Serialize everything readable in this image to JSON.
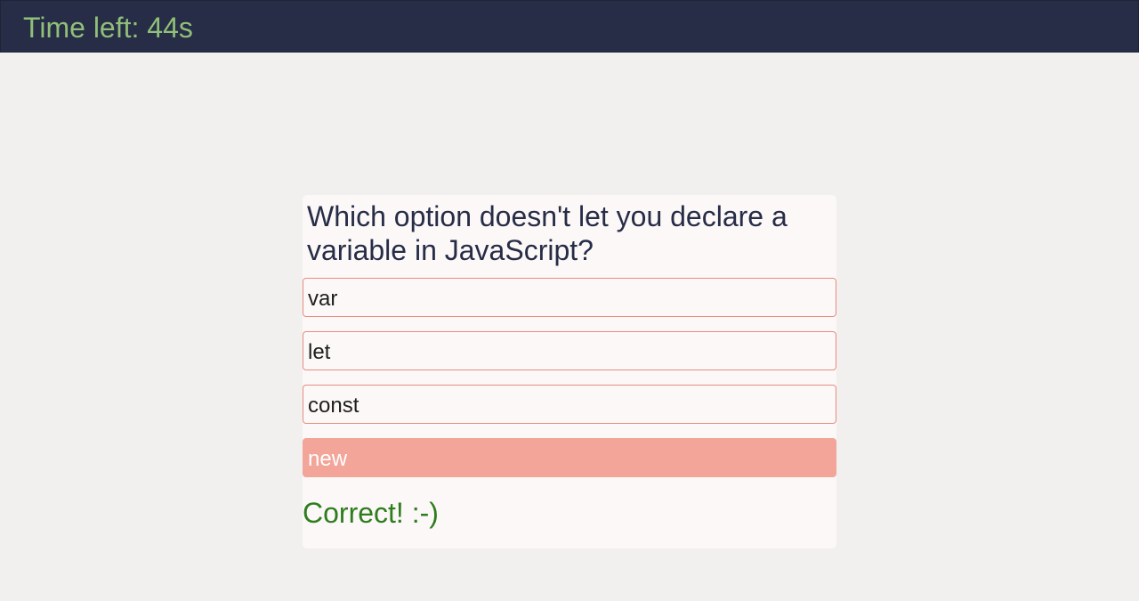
{
  "header": {
    "timer_text": "Time left: 44s"
  },
  "quiz": {
    "question": "Which option doesn't let you declare a variable in JavaScript?",
    "options": [
      {
        "label": "var",
        "selected": false
      },
      {
        "label": "let",
        "selected": false
      },
      {
        "label": "const",
        "selected": false
      },
      {
        "label": "new",
        "selected": true
      }
    ],
    "result": "Correct! :-)"
  },
  "colors": {
    "header_bg": "#272c47",
    "timer_text": "#8fbf78",
    "option_border": "#e98b80",
    "selected_bg": "#f2a598",
    "correct_text": "#2f7d1e"
  }
}
